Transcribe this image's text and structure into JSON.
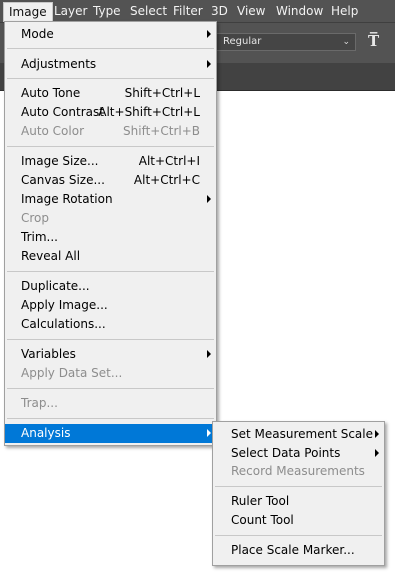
{
  "menubar": {
    "items": [
      "Image",
      "Layer",
      "Type",
      "Select",
      "Filter",
      "3D",
      "View",
      "Window",
      "Help"
    ]
  },
  "options": {
    "font_style": "Regular"
  },
  "image_menu": {
    "mode": "Mode",
    "adjustments": "Adjustments",
    "auto_tone": {
      "label": "Auto Tone",
      "shortcut": "Shift+Ctrl+L"
    },
    "auto_contrast": {
      "label": "Auto Contrast",
      "shortcut": "Alt+Shift+Ctrl+L"
    },
    "auto_color": {
      "label": "Auto Color",
      "shortcut": "Shift+Ctrl+B"
    },
    "image_size": {
      "label": "Image Size...",
      "shortcut": "Alt+Ctrl+I"
    },
    "canvas_size": {
      "label": "Canvas Size...",
      "shortcut": "Alt+Ctrl+C"
    },
    "image_rotation": "Image Rotation",
    "crop": "Crop",
    "trim": "Trim...",
    "reveal_all": "Reveal All",
    "duplicate": "Duplicate...",
    "apply_image": "Apply Image...",
    "calculations": "Calculations...",
    "variables": "Variables",
    "apply_data_set": "Apply Data Set...",
    "trap": "Trap...",
    "analysis": "Analysis"
  },
  "analysis_menu": {
    "set_measurement_scale": "Set Measurement Scale",
    "select_data_points": "Select Data Points",
    "record_measurements": "Record Measurements",
    "ruler_tool": "Ruler Tool",
    "count_tool": "Count Tool",
    "place_scale_marker": "Place Scale Marker..."
  }
}
